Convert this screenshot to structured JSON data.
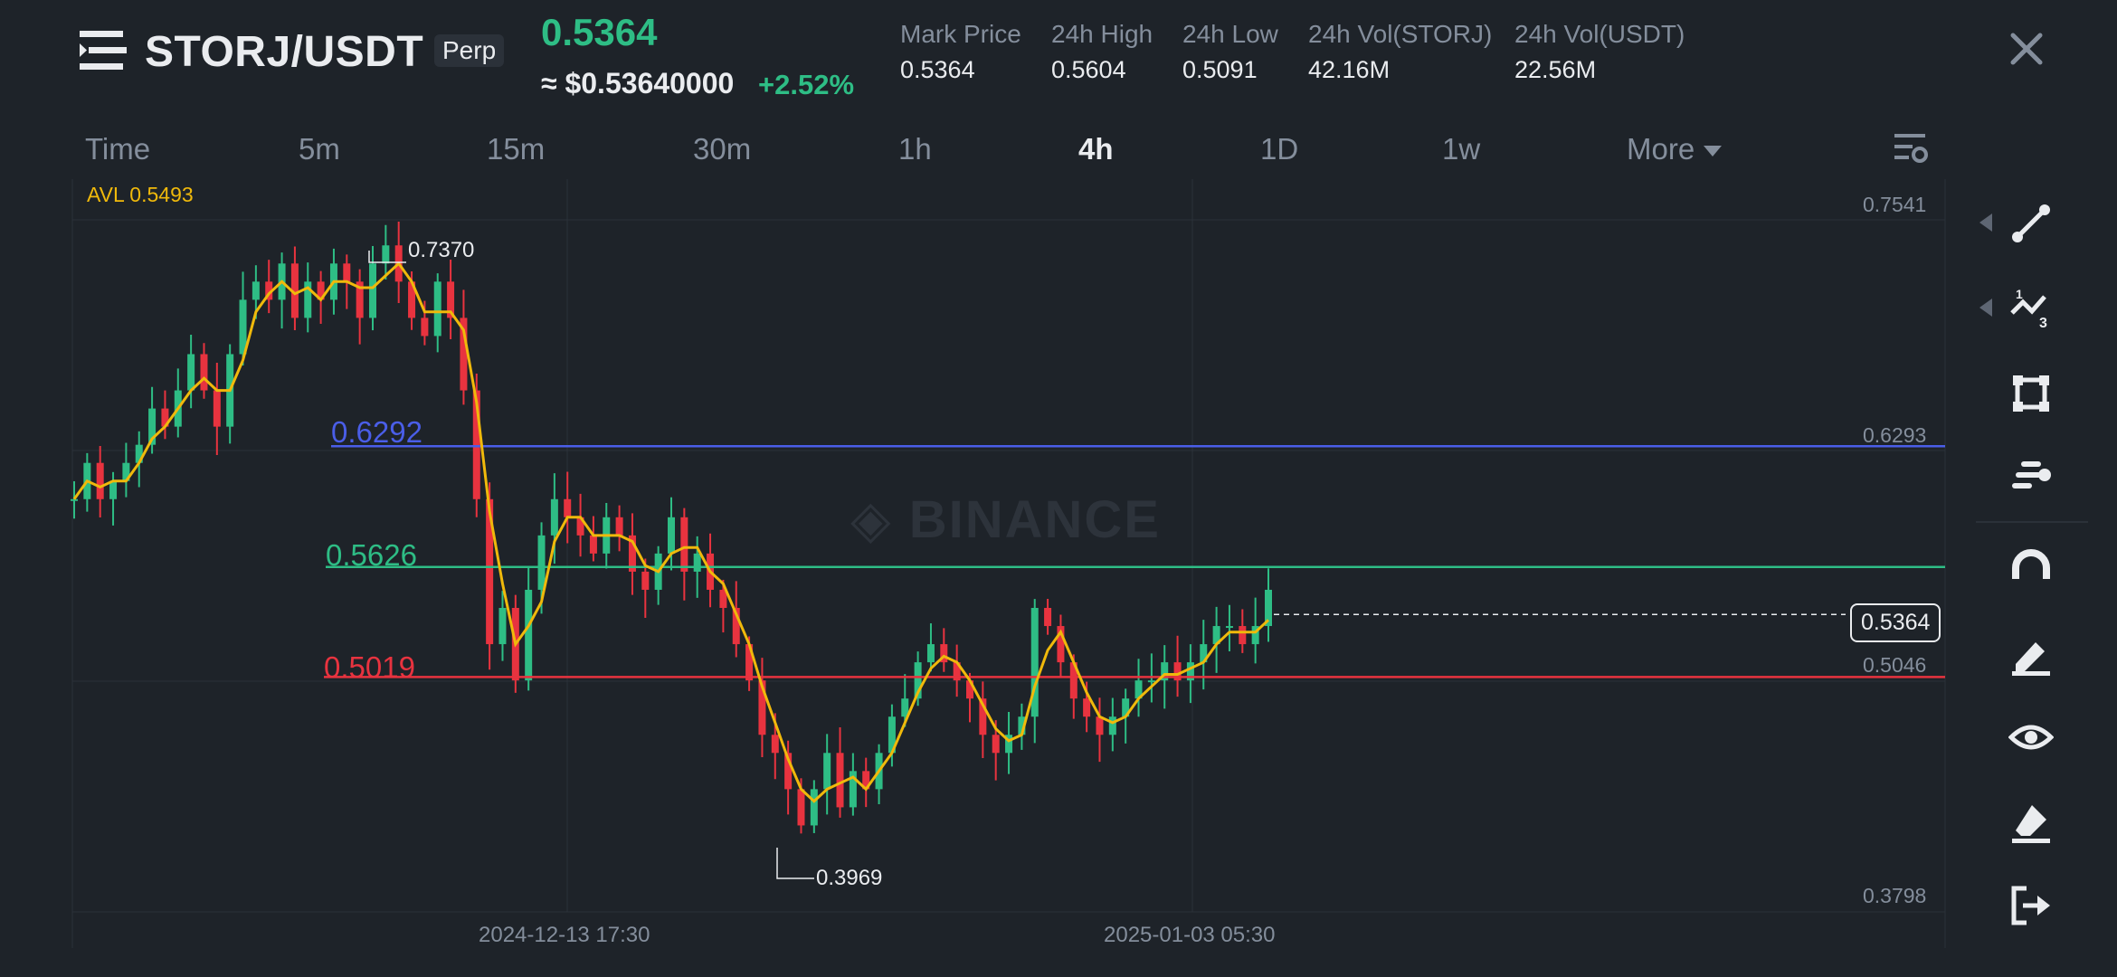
{
  "header": {
    "pair": "STORJ/USDT",
    "badge": "Perp",
    "last_price": "0.5364",
    "approx_usd": "≈ $0.53640000",
    "change_pct": "+2.52%",
    "stats": [
      {
        "label": "Mark Price",
        "value": "0.5364"
      },
      {
        "label": "24h High",
        "value": "0.5604"
      },
      {
        "label": "24h Low",
        "value": "0.5091"
      },
      {
        "label": "24h Vol(STORJ)",
        "value": "42.16M"
      },
      {
        "label": "24h Vol(USDT)",
        "value": "22.56M"
      }
    ]
  },
  "intervals": {
    "items": [
      "Time",
      "5m",
      "15m",
      "30m",
      "1h",
      "4h",
      "1D",
      "1w",
      "More"
    ],
    "active": "4h"
  },
  "chart": {
    "avl": "AVL 0.5493",
    "watermark": "BINANCE",
    "right_axis": [
      "0.7541",
      "0.6293",
      "0.5046",
      "0.3798"
    ],
    "current_price_tag": "0.5364",
    "high_label": "0.7370",
    "low_label": "0.3969",
    "time_labels": [
      "2024-12-13 17:30",
      "2025-01-03 05:30"
    ],
    "levels": [
      {
        "label": "0.6292",
        "value": 0.6292,
        "color": "#4a5ee8"
      },
      {
        "label": "0.5626",
        "value": 0.5626,
        "color": "#2ebd85"
      },
      {
        "label": "0.5019",
        "value": 0.5019,
        "color": "#e8333f"
      }
    ],
    "colors": {
      "up": "#2ebd85",
      "down": "#e8333f",
      "ma": "#f0b90b"
    }
  },
  "chart_data": {
    "type": "line",
    "title": "",
    "xlabel": "",
    "ylabel": "",
    "ylim": [
      0.3798,
      0.7541
    ],
    "x_ticks": [
      "2024-12-13 17:30",
      "2025-01-03 05:30"
    ],
    "series": [
      {
        "values": [
          0.6,
          0.62,
          0.6,
          0.61,
          0.62,
          0.63,
          0.65,
          0.64,
          0.66,
          0.68,
          0.66,
          0.64,
          0.68,
          0.71,
          0.72,
          0.71,
          0.73,
          0.7,
          0.72,
          0.71,
          0.73,
          0.72,
          0.7,
          0.73,
          0.74,
          0.72,
          0.7,
          0.69,
          0.72,
          0.7,
          0.66,
          0.6,
          0.52,
          0.54,
          0.5,
          0.55,
          0.58,
          0.6,
          0.59,
          0.58,
          0.57,
          0.59,
          0.58,
          0.56,
          0.55,
          0.57,
          0.59,
          0.56,
          0.57,
          0.55,
          0.54,
          0.52,
          0.5,
          0.47,
          0.46,
          0.44,
          0.42,
          0.44,
          0.46,
          0.43,
          0.45,
          0.44,
          0.46,
          0.48,
          0.49,
          0.51,
          0.52,
          0.51,
          0.5,
          0.49,
          0.47,
          0.46,
          0.47,
          0.48,
          0.54,
          0.53,
          0.51,
          0.49,
          0.48,
          0.47,
          0.48,
          0.49,
          0.5,
          0.5,
          0.51,
          0.5,
          0.51,
          0.52,
          0.53,
          0.53,
          0.52,
          0.53,
          0.55
        ]
      }
    ]
  },
  "toolbar": {
    "items": [
      "line-tool-icon",
      "fibonacci-tool-icon",
      "shape-tool-icon",
      "text-tool-icon",
      "magnet-icon",
      "brush-icon",
      "eye-icon",
      "eraser-icon",
      "exit-icon"
    ]
  }
}
